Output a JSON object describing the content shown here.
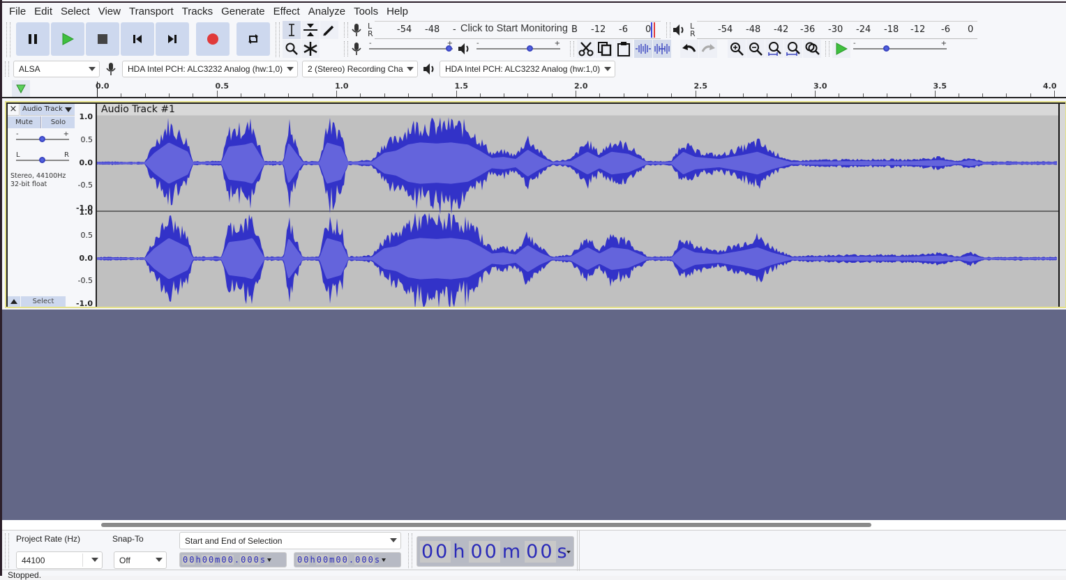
{
  "menu": [
    "File",
    "Edit",
    "Select",
    "View",
    "Transport",
    "Tracks",
    "Generate",
    "Effect",
    "Analyze",
    "Tools",
    "Help"
  ],
  "transport": {
    "buttons": [
      {
        "name": "pause-button",
        "icon": "pause-icon"
      },
      {
        "name": "play-button",
        "icon": "play-icon"
      },
      {
        "name": "stop-button",
        "icon": "stop-icon"
      },
      {
        "name": "skip-to-start-button",
        "icon": "skip-start-icon"
      },
      {
        "name": "skip-to-end-button",
        "icon": "skip-end-icon"
      },
      {
        "name": "record-button",
        "icon": "record-icon"
      },
      {
        "name": "loop-button",
        "icon": "loop-icon"
      }
    ],
    "colors": {
      "play": "#3fbf3f",
      "record": "#e03a3a",
      "button_bg": "#cdd8ee"
    }
  },
  "tools": [
    "selection-tool",
    "envelope-tool",
    "draw-tool",
    "zoom-tool",
    "multi-tool"
  ],
  "record_meter": {
    "labels": [
      "-54",
      "-48",
      "-"
    ],
    "right_labels": [
      "B",
      "-12",
      "-6",
      "0"
    ],
    "monitor_text": "Click to Start Monitoring",
    "lr": [
      "L",
      "R"
    ]
  },
  "play_meter": {
    "labels": [
      "-54",
      "-48",
      "-42",
      "-36",
      "-30",
      "-24",
      "-18",
      "-12",
      "-6",
      "0"
    ],
    "lr": [
      "L",
      "R"
    ]
  },
  "mixer": {
    "record_volume": 1.0,
    "playback_volume": 0.65,
    "minus": "-",
    "plus": "+"
  },
  "play_at_speed": {
    "speed": 0.35,
    "minus": "-",
    "plus": "+"
  },
  "device": {
    "host": "ALSA",
    "recording_device": "HDA Intel PCH: ALC3232 Analog (hw:1,0)",
    "channels": "2 (Stereo) Recording Cha",
    "playback_device": "HDA Intel PCH: ALC3232 Analog (hw:1,0)"
  },
  "ruler": {
    "labels": [
      "0.0",
      "0.5",
      "1.0",
      "1.5",
      "2.0",
      "2.5",
      "3.0",
      "3.5",
      "4.0"
    ]
  },
  "track": {
    "close": "×",
    "name_menu": "Audio Track",
    "mute": "Mute",
    "solo": "Solo",
    "gain_minus": "-",
    "gain_plus": "+",
    "gain": 0.5,
    "pan_left": "L",
    "pan_right": "R",
    "pan": 0.5,
    "info1": "Stereo, 44100Hz",
    "info2": "32-bit float",
    "select": "Select",
    "clip_title": "Audio Track #1",
    "vruler": [
      "1.0",
      "0.5",
      "0.0",
      "-0.5",
      "-1.0"
    ],
    "wave_color": "#3232c8",
    "wave_rms_color": "#6464dc",
    "envelope": [
      [
        0.0,
        0.04
      ],
      [
        0.2,
        0.03
      ],
      [
        0.24,
        0.5
      ],
      [
        0.3,
        1.0
      ],
      [
        0.38,
        0.55
      ],
      [
        0.4,
        0.05
      ],
      [
        0.52,
        0.05
      ],
      [
        0.55,
        0.8
      ],
      [
        0.62,
        0.9
      ],
      [
        0.65,
        1.0
      ],
      [
        0.7,
        0.05
      ],
      [
        0.78,
        0.05
      ],
      [
        0.8,
        1.0
      ],
      [
        0.86,
        0.05
      ],
      [
        0.93,
        0.05
      ],
      [
        0.96,
        1.0
      ],
      [
        1.02,
        0.8
      ],
      [
        1.05,
        0.05
      ],
      [
        1.15,
        0.08
      ],
      [
        1.2,
        0.5
      ],
      [
        1.25,
        0.6
      ],
      [
        1.3,
        0.9
      ],
      [
        1.35,
        1.0
      ],
      [
        1.42,
        0.95
      ],
      [
        1.48,
        1.0
      ],
      [
        1.55,
        0.9
      ],
      [
        1.6,
        0.6
      ],
      [
        1.65,
        0.25
      ],
      [
        1.7,
        0.3
      ],
      [
        1.75,
        0.2
      ],
      [
        1.8,
        0.65
      ],
      [
        1.85,
        0.3
      ],
      [
        1.9,
        0.05
      ],
      [
        1.98,
        0.1
      ],
      [
        2.05,
        0.55
      ],
      [
        2.1,
        0.25
      ],
      [
        2.15,
        0.55
      ],
      [
        2.22,
        0.45
      ],
      [
        2.3,
        0.05
      ],
      [
        2.4,
        0.05
      ],
      [
        2.45,
        0.55
      ],
      [
        2.5,
        0.3
      ],
      [
        2.6,
        0.2
      ],
      [
        2.7,
        0.4
      ],
      [
        2.76,
        0.55
      ],
      [
        2.82,
        0.3
      ],
      [
        2.9,
        0.06
      ],
      [
        3.0,
        0.08
      ],
      [
        3.2,
        0.1
      ],
      [
        3.4,
        0.09
      ],
      [
        3.52,
        0.15
      ],
      [
        3.6,
        0.05
      ],
      [
        3.65,
        0.15
      ],
      [
        3.7,
        0.04
      ],
      [
        4.03,
        0.04
      ]
    ]
  },
  "selection_toolbar": {
    "project_rate_label": "Project Rate (Hz)",
    "project_rate": "44100",
    "snap_label": "Snap-To",
    "snap": "Off",
    "selection_mode": "Start and End of Selection",
    "start_time": [
      "0",
      "0",
      "h",
      "0",
      "0",
      "m",
      "0",
      "0",
      ".",
      "0",
      "0",
      "0",
      "s"
    ],
    "end_time": [
      "0",
      "0",
      "h",
      "0",
      "0",
      "m",
      "0",
      "0",
      ".",
      "0",
      "0",
      "0",
      "s"
    ]
  },
  "audio_position": {
    "hh": "00",
    "h": "h",
    "mm": "00",
    "m": "m",
    "ss": "00",
    "s": "s"
  },
  "status": "Stopped."
}
